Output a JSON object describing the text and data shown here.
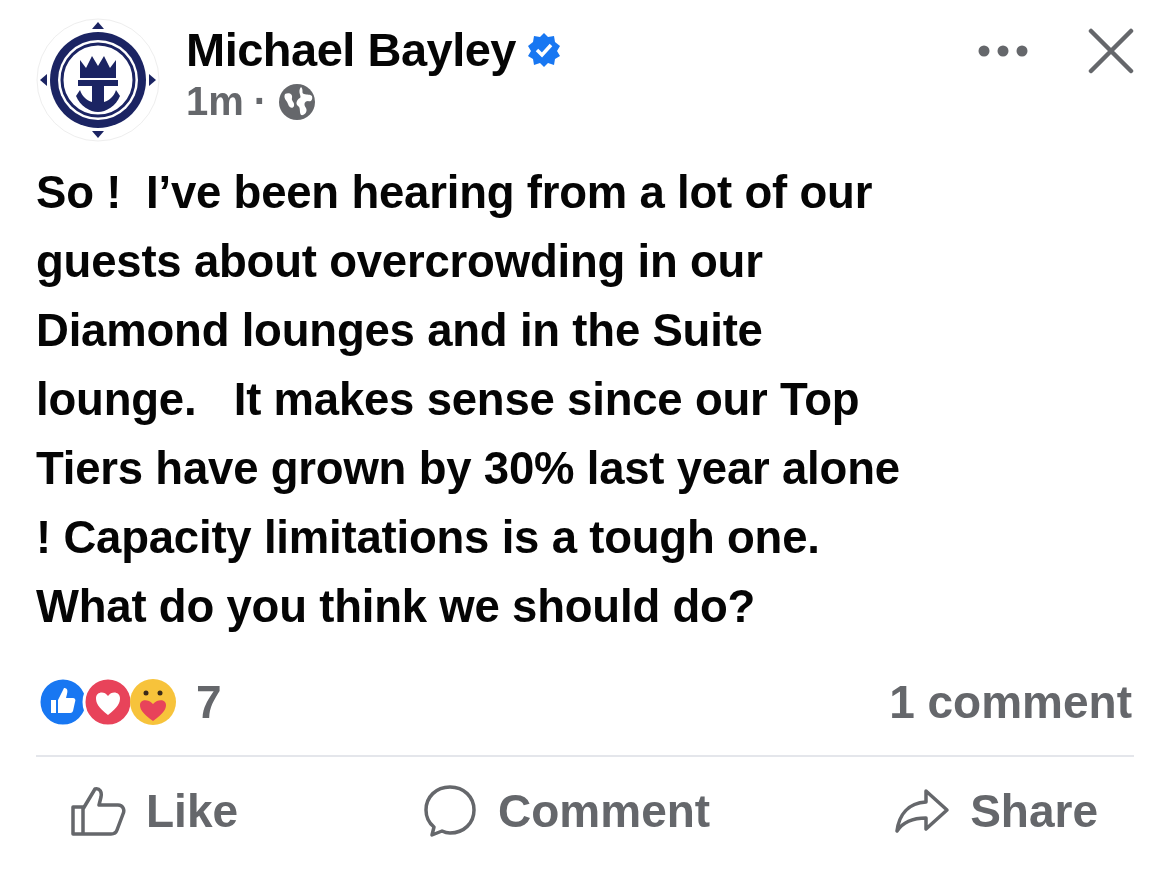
{
  "post": {
    "author": "Michael Bayley",
    "verified": true,
    "time": "1m",
    "separator": "·",
    "text": "So !  I’ve been hearing from a lot of our\nguests about overcrowding in our\nDiamond lounges and in the Suite\nlounge.   It makes sense since our Top\nTiers have grown by 30% last year alone\n! Capacity limitations is a tough one.\nWhat do you think we should do?",
    "reactions": {
      "count": "7",
      "comments": "1 comment"
    },
    "actions": [
      {
        "kind": "like",
        "label": "Like"
      },
      {
        "kind": "comment",
        "label": "Comment"
      },
      {
        "kind": "share",
        "label": "Share"
      }
    ]
  }
}
